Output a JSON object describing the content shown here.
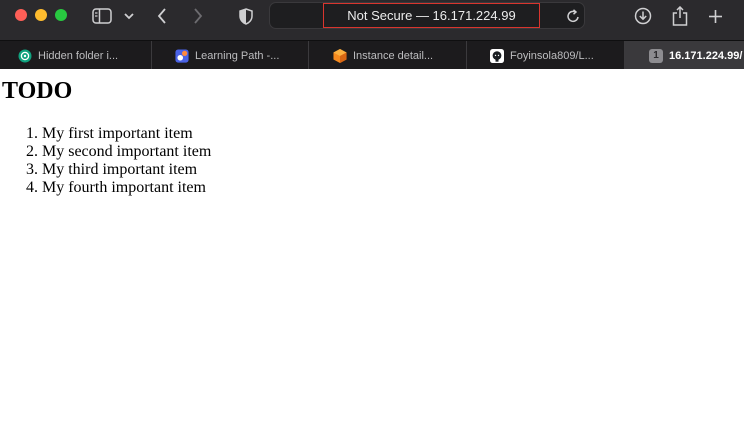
{
  "window": {
    "url_display": "Not Secure — 16.171.224.99"
  },
  "tabs": [
    {
      "label": "Hidden folder i...",
      "icon": "chatgpt-icon"
    },
    {
      "label": "Learning Path -...",
      "icon": "learning-path-icon"
    },
    {
      "label": "Instance detail...",
      "icon": "aws-ec2-icon"
    },
    {
      "label": "Foyinsola809/L...",
      "icon": "github-icon"
    },
    {
      "label": "16.171.224.99/",
      "icon": "numbered-tab-icon",
      "badge": "1",
      "active": true
    }
  ],
  "page": {
    "heading": "TODO",
    "items": [
      "My first important item",
      "My second important item",
      "My third important item",
      "My fourth important item"
    ]
  },
  "colors": {
    "toolbar_bg": "#2b2a2d",
    "tabstrip_bg": "#1c1b1d",
    "active_tab_bg": "#3a393c",
    "url_highlight": "#d9352e"
  }
}
